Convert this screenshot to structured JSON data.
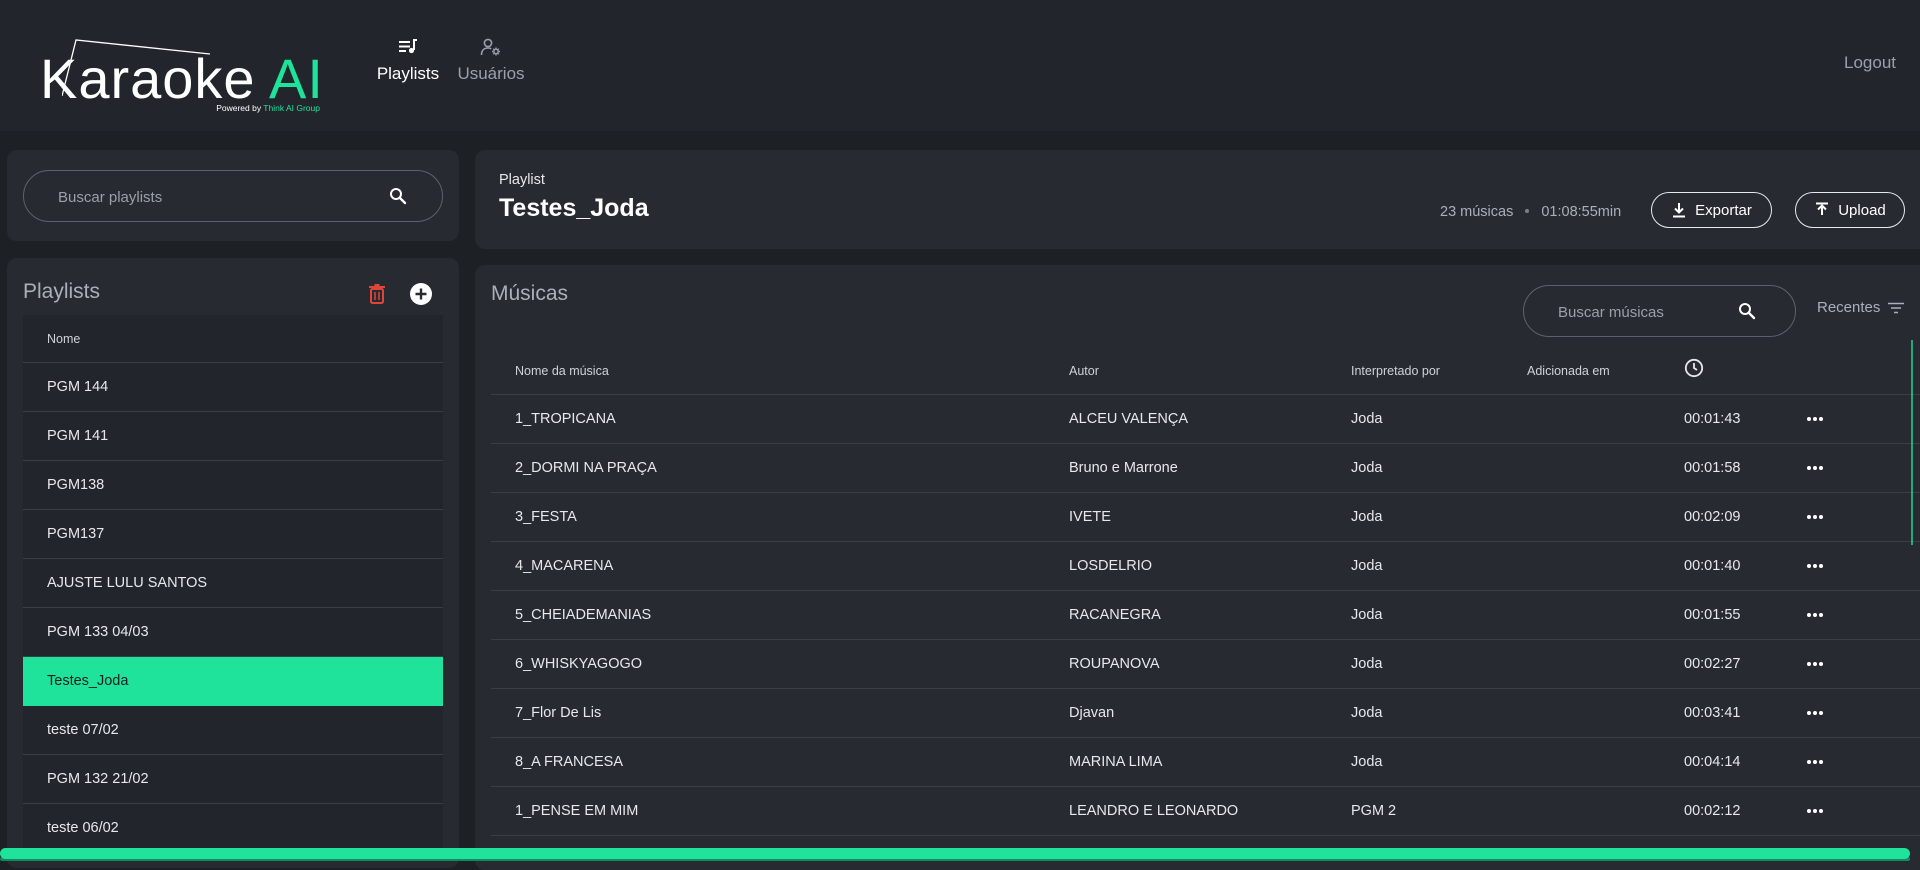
{
  "header": {
    "logo": {
      "word": "Karaoke",
      "accent": "AI",
      "tagline": "Powered by",
      "tagline_brand": "Think AI Group"
    },
    "nav": [
      {
        "label": "Playlists",
        "icon": "playlist-music-icon",
        "active": true
      },
      {
        "label": "Usuários",
        "icon": "users-settings-icon",
        "active": false
      }
    ],
    "logout": "Logout"
  },
  "sidebar": {
    "search_placeholder": "Buscar playlists",
    "title": "Playlists",
    "column_header": "Nome",
    "items": [
      {
        "label": "PGM 144"
      },
      {
        "label": "PGM 141"
      },
      {
        "label": "PGM138"
      },
      {
        "label": "PGM137"
      },
      {
        "label": "AJUSTE LULU SANTOS"
      },
      {
        "label": "PGM 133 04/03"
      },
      {
        "label": "Testes_Joda",
        "active": true
      },
      {
        "label": "teste 07/02"
      },
      {
        "label": "PGM 132 21/02"
      },
      {
        "label": "teste 06/02"
      }
    ]
  },
  "playlist_info": {
    "label": "Playlist",
    "name": "Testes_Joda",
    "song_count": "23 músicas",
    "total_duration": "01:08:55min",
    "export_label": "Exportar",
    "upload_label": "Upload"
  },
  "songs": {
    "title": "Músicas",
    "search_placeholder": "Buscar músicas",
    "sort_label": "Recentes",
    "columns": {
      "name": "Nome da música",
      "author": "Autor",
      "interpreter": "Interpretado por",
      "added": "Adicionada em",
      "duration_icon": "clock-icon"
    },
    "rows": [
      {
        "name": "1_TROPICANA",
        "author": "ALCEU VALENÇA",
        "interpreter": "Joda",
        "added": "",
        "duration": "00:01:43"
      },
      {
        "name": "2_DORMI NA PRAÇA",
        "author": "Bruno e Marrone",
        "interpreter": "Joda",
        "added": "",
        "duration": "00:01:58"
      },
      {
        "name": "3_FESTA",
        "author": "IVETE",
        "interpreter": "Joda",
        "added": "",
        "duration": "00:02:09"
      },
      {
        "name": "4_MACARENA",
        "author": "LOSDELRIO",
        "interpreter": "Joda",
        "added": "",
        "duration": "00:01:40"
      },
      {
        "name": "5_CHEIADEMANIAS",
        "author": "RACANEGRA",
        "interpreter": "Joda",
        "added": "",
        "duration": "00:01:55"
      },
      {
        "name": "6_WHISKYAGOGO",
        "author": "ROUPANOVA",
        "interpreter": "Joda",
        "added": "",
        "duration": "00:02:27"
      },
      {
        "name": "7_Flor De Lis",
        "author": "Djavan",
        "interpreter": "Joda",
        "added": "",
        "duration": "00:03:41"
      },
      {
        "name": "8_A FRANCESA",
        "author": "MARINA LIMA",
        "interpreter": "Joda",
        "added": "",
        "duration": "00:04:14"
      },
      {
        "name": "1_PENSE EM MIM",
        "author": "LEANDRO E LEONARDO",
        "interpreter": "PGM 2",
        "added": "",
        "duration": "00:02:12"
      }
    ]
  },
  "colors": {
    "accent": "#1fe39a",
    "background": "#1d2025",
    "card": "#272b31",
    "danger": "#e0453a"
  }
}
